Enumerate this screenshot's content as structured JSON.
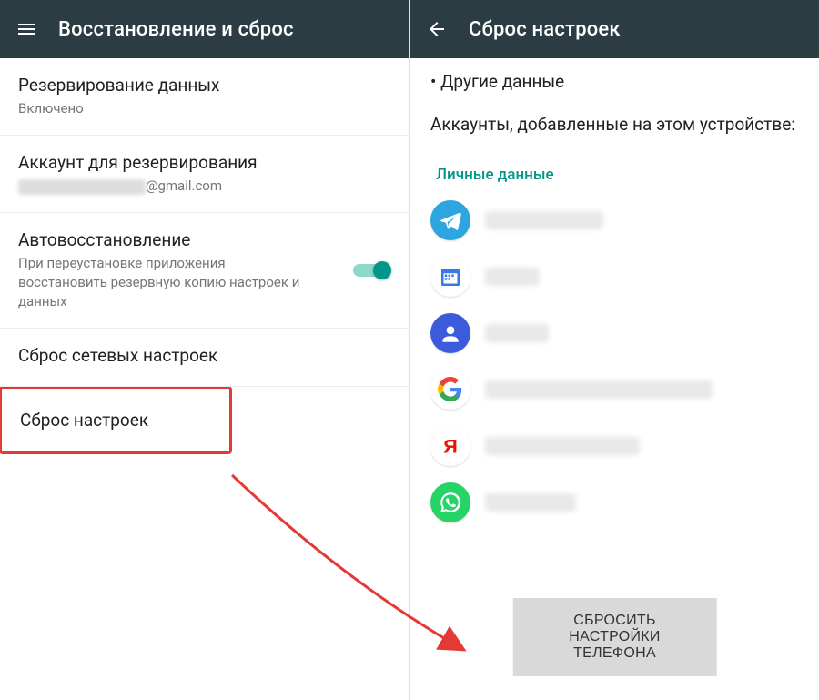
{
  "left": {
    "title": "Восстановление и сброс",
    "items": {
      "backup": {
        "primary": "Резервирование данных",
        "secondary": "Включено"
      },
      "account": {
        "primary": "Аккаунт для резервирования",
        "suffix": "@gmail.com"
      },
      "autorestore": {
        "primary": "Автовосстановление",
        "secondary": "При переустановке приложения восстановить резервную копию настроек и данных",
        "toggle": true
      },
      "network_reset": {
        "primary": "Сброс сетевых настроек"
      },
      "factory_reset": {
        "primary": "Сброс настроек"
      }
    }
  },
  "right": {
    "title": "Сброс настроек",
    "other_data": "• Другие данные",
    "accounts_header": "Аккаунты, добавленные на этом устройстве:",
    "section_label": "Личные данные",
    "reset_button": "СБРОСИТЬ НАСТРОЙКИ ТЕЛЕФОНА",
    "accounts": [
      {
        "name": "telegram"
      },
      {
        "name": "calendar"
      },
      {
        "name": "contacts"
      },
      {
        "name": "google"
      },
      {
        "name": "yandex"
      },
      {
        "name": "whatsapp"
      }
    ]
  }
}
